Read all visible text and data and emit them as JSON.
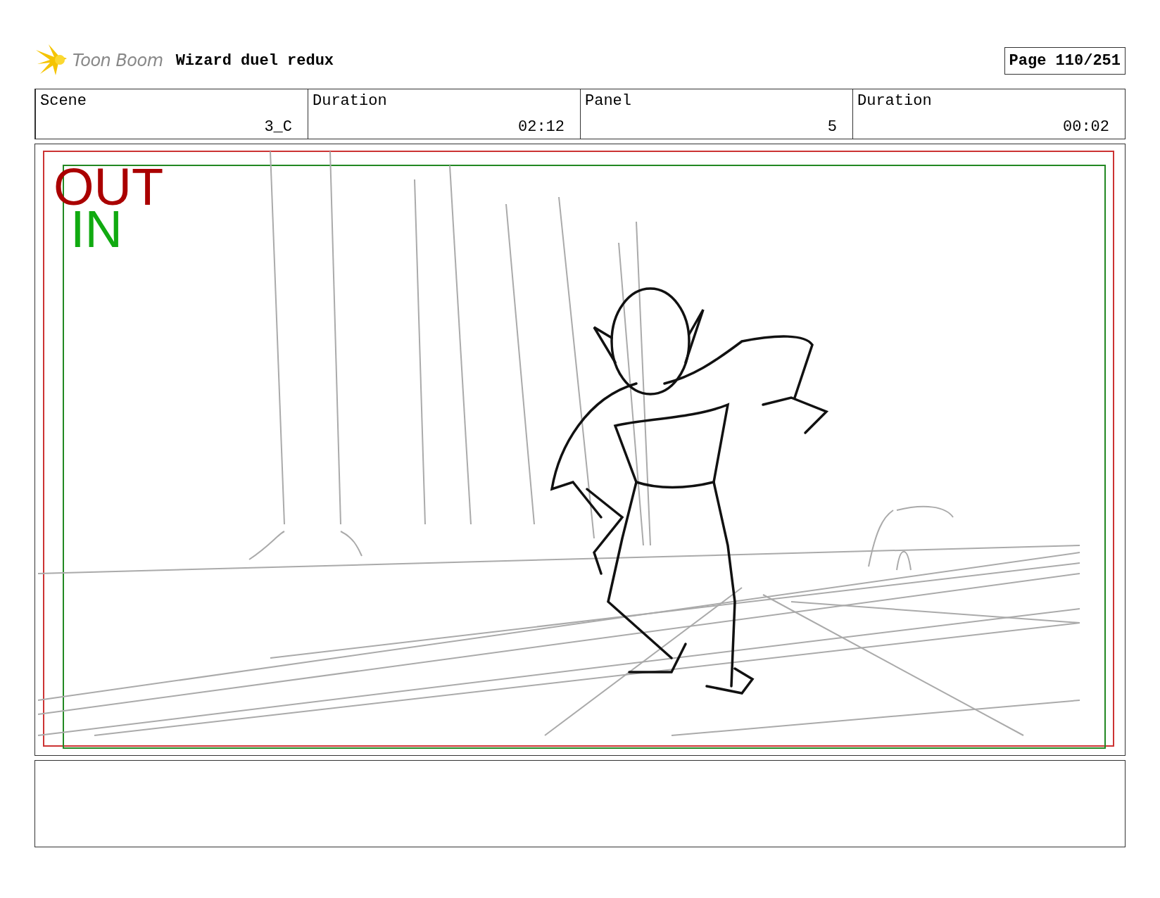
{
  "header": {
    "logo_text": "Toon Boom",
    "title": "Wizard duel redux",
    "page": "Page 110/251"
  },
  "info": [
    {
      "label": "Scene",
      "value": "3_C"
    },
    {
      "label": "Duration",
      "value": "02:12"
    },
    {
      "label": "Panel",
      "value": "5"
    },
    {
      "label": "Duration",
      "value": "00:02"
    }
  ],
  "panel": {
    "frame_labels": [
      {
        "text": "OUT",
        "color": "#aa0000"
      },
      {
        "text": "IN",
        "color": "#11aa11"
      }
    ]
  }
}
